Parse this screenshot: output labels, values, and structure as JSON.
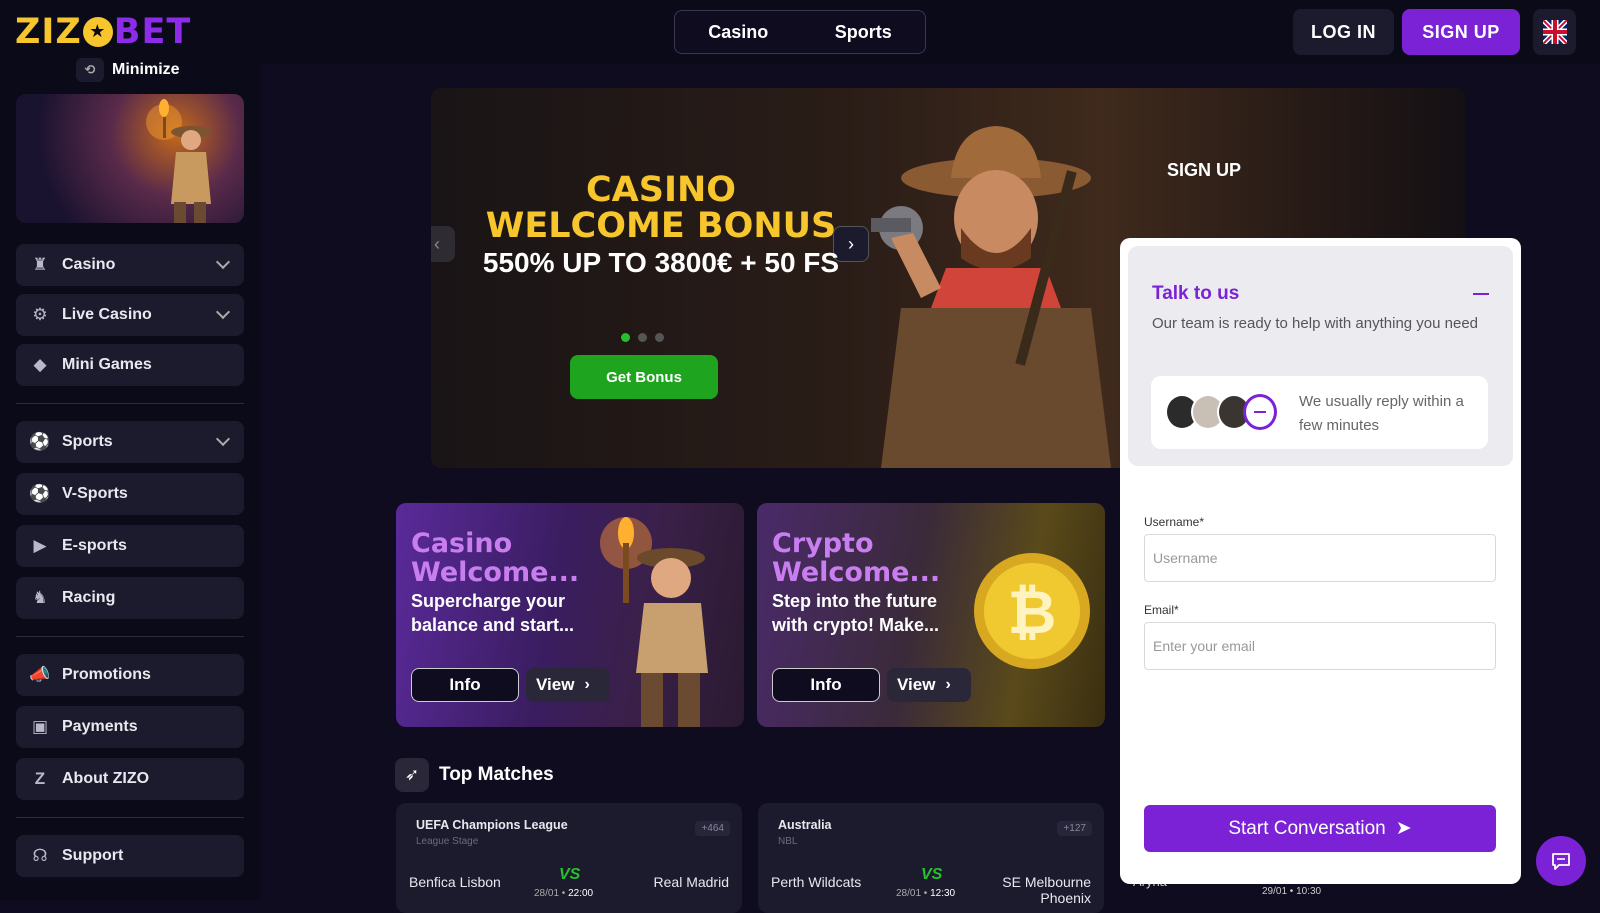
{
  "brand": {
    "logo_left": "ZIZ",
    "logo_right": "BET"
  },
  "header": {
    "switch": [
      "Casino",
      "Sports"
    ],
    "login_label": "LOG IN",
    "signup_label": "SIGN UP"
  },
  "sidebar": {
    "minimize_label": "Minimize",
    "items": [
      {
        "label": "Casino",
        "icon": "casino-icon",
        "expandable": true
      },
      {
        "label": "Live Casino",
        "icon": "live-casino-icon",
        "expandable": true
      },
      {
        "label": "Mini Games",
        "icon": "diamond-icon",
        "expandable": false
      },
      {
        "label": "Sports",
        "icon": "soccer-ball-icon",
        "expandable": true
      },
      {
        "label": "V-Sports",
        "icon": "v-sports-icon",
        "expandable": false
      },
      {
        "label": "E-sports",
        "icon": "play-icon",
        "expandable": false
      },
      {
        "label": "Racing",
        "icon": "horse-icon",
        "expandable": false
      },
      {
        "label": "Promotions",
        "icon": "megaphone-icon",
        "expandable": false
      },
      {
        "label": "Payments",
        "icon": "wallet-icon",
        "expandable": false
      },
      {
        "label": "About ZIZO",
        "icon": "zizo-icon",
        "expandable": false
      },
      {
        "label": "Support",
        "icon": "headset-icon",
        "expandable": false
      }
    ]
  },
  "hero": {
    "title_line1": "CASINO",
    "title_line2": "WELCOME BONUS",
    "subtitle": "550% UP TO 3800€ + 50 FS",
    "button_label": "Get Bonus",
    "signup_label": "SIGN UP",
    "active_slide": 1,
    "total_slides": 3
  },
  "promos": [
    {
      "title": "Casino Welcome...",
      "desc": "Supercharge your balance and start...",
      "info_label": "Info",
      "view_label": "View"
    },
    {
      "title": "Crypto Welcome...",
      "desc": "Step into the future with crypto! Make...",
      "info_label": "Info",
      "view_label": "View"
    }
  ],
  "top_matches": {
    "heading": "Top Matches",
    "matches": [
      {
        "league": "UEFA Champions League",
        "stage": "League Stage",
        "count": "+464",
        "home": "Benfica Lisbon",
        "vs": "VS",
        "date": "28/01",
        "time": "22:00",
        "away": "Real Madrid"
      },
      {
        "league": "Australia",
        "stage": "NBL",
        "count": "+127",
        "home": "Perth Wildcats",
        "vs": "VS",
        "date": "28/01",
        "time": "12:30",
        "away": "SE Melbourne Phoenix"
      }
    ],
    "partial_third": {
      "home": "Aryna",
      "date": "29/01",
      "time": "10:30"
    }
  },
  "chat": {
    "title": "Talk to us",
    "desc": "Our team is ready to help with anything you need",
    "reply_text": "We usually reply within a few minutes",
    "username_label": "Username*",
    "username_placeholder": "Username",
    "email_label": "Email*",
    "email_placeholder": "Enter your email",
    "start_label": "Start Conversation"
  },
  "colors": {
    "accent": "#7b22d6",
    "gold": "#f7c52c",
    "green": "#27c02d",
    "bg": "#0e0c1e"
  }
}
